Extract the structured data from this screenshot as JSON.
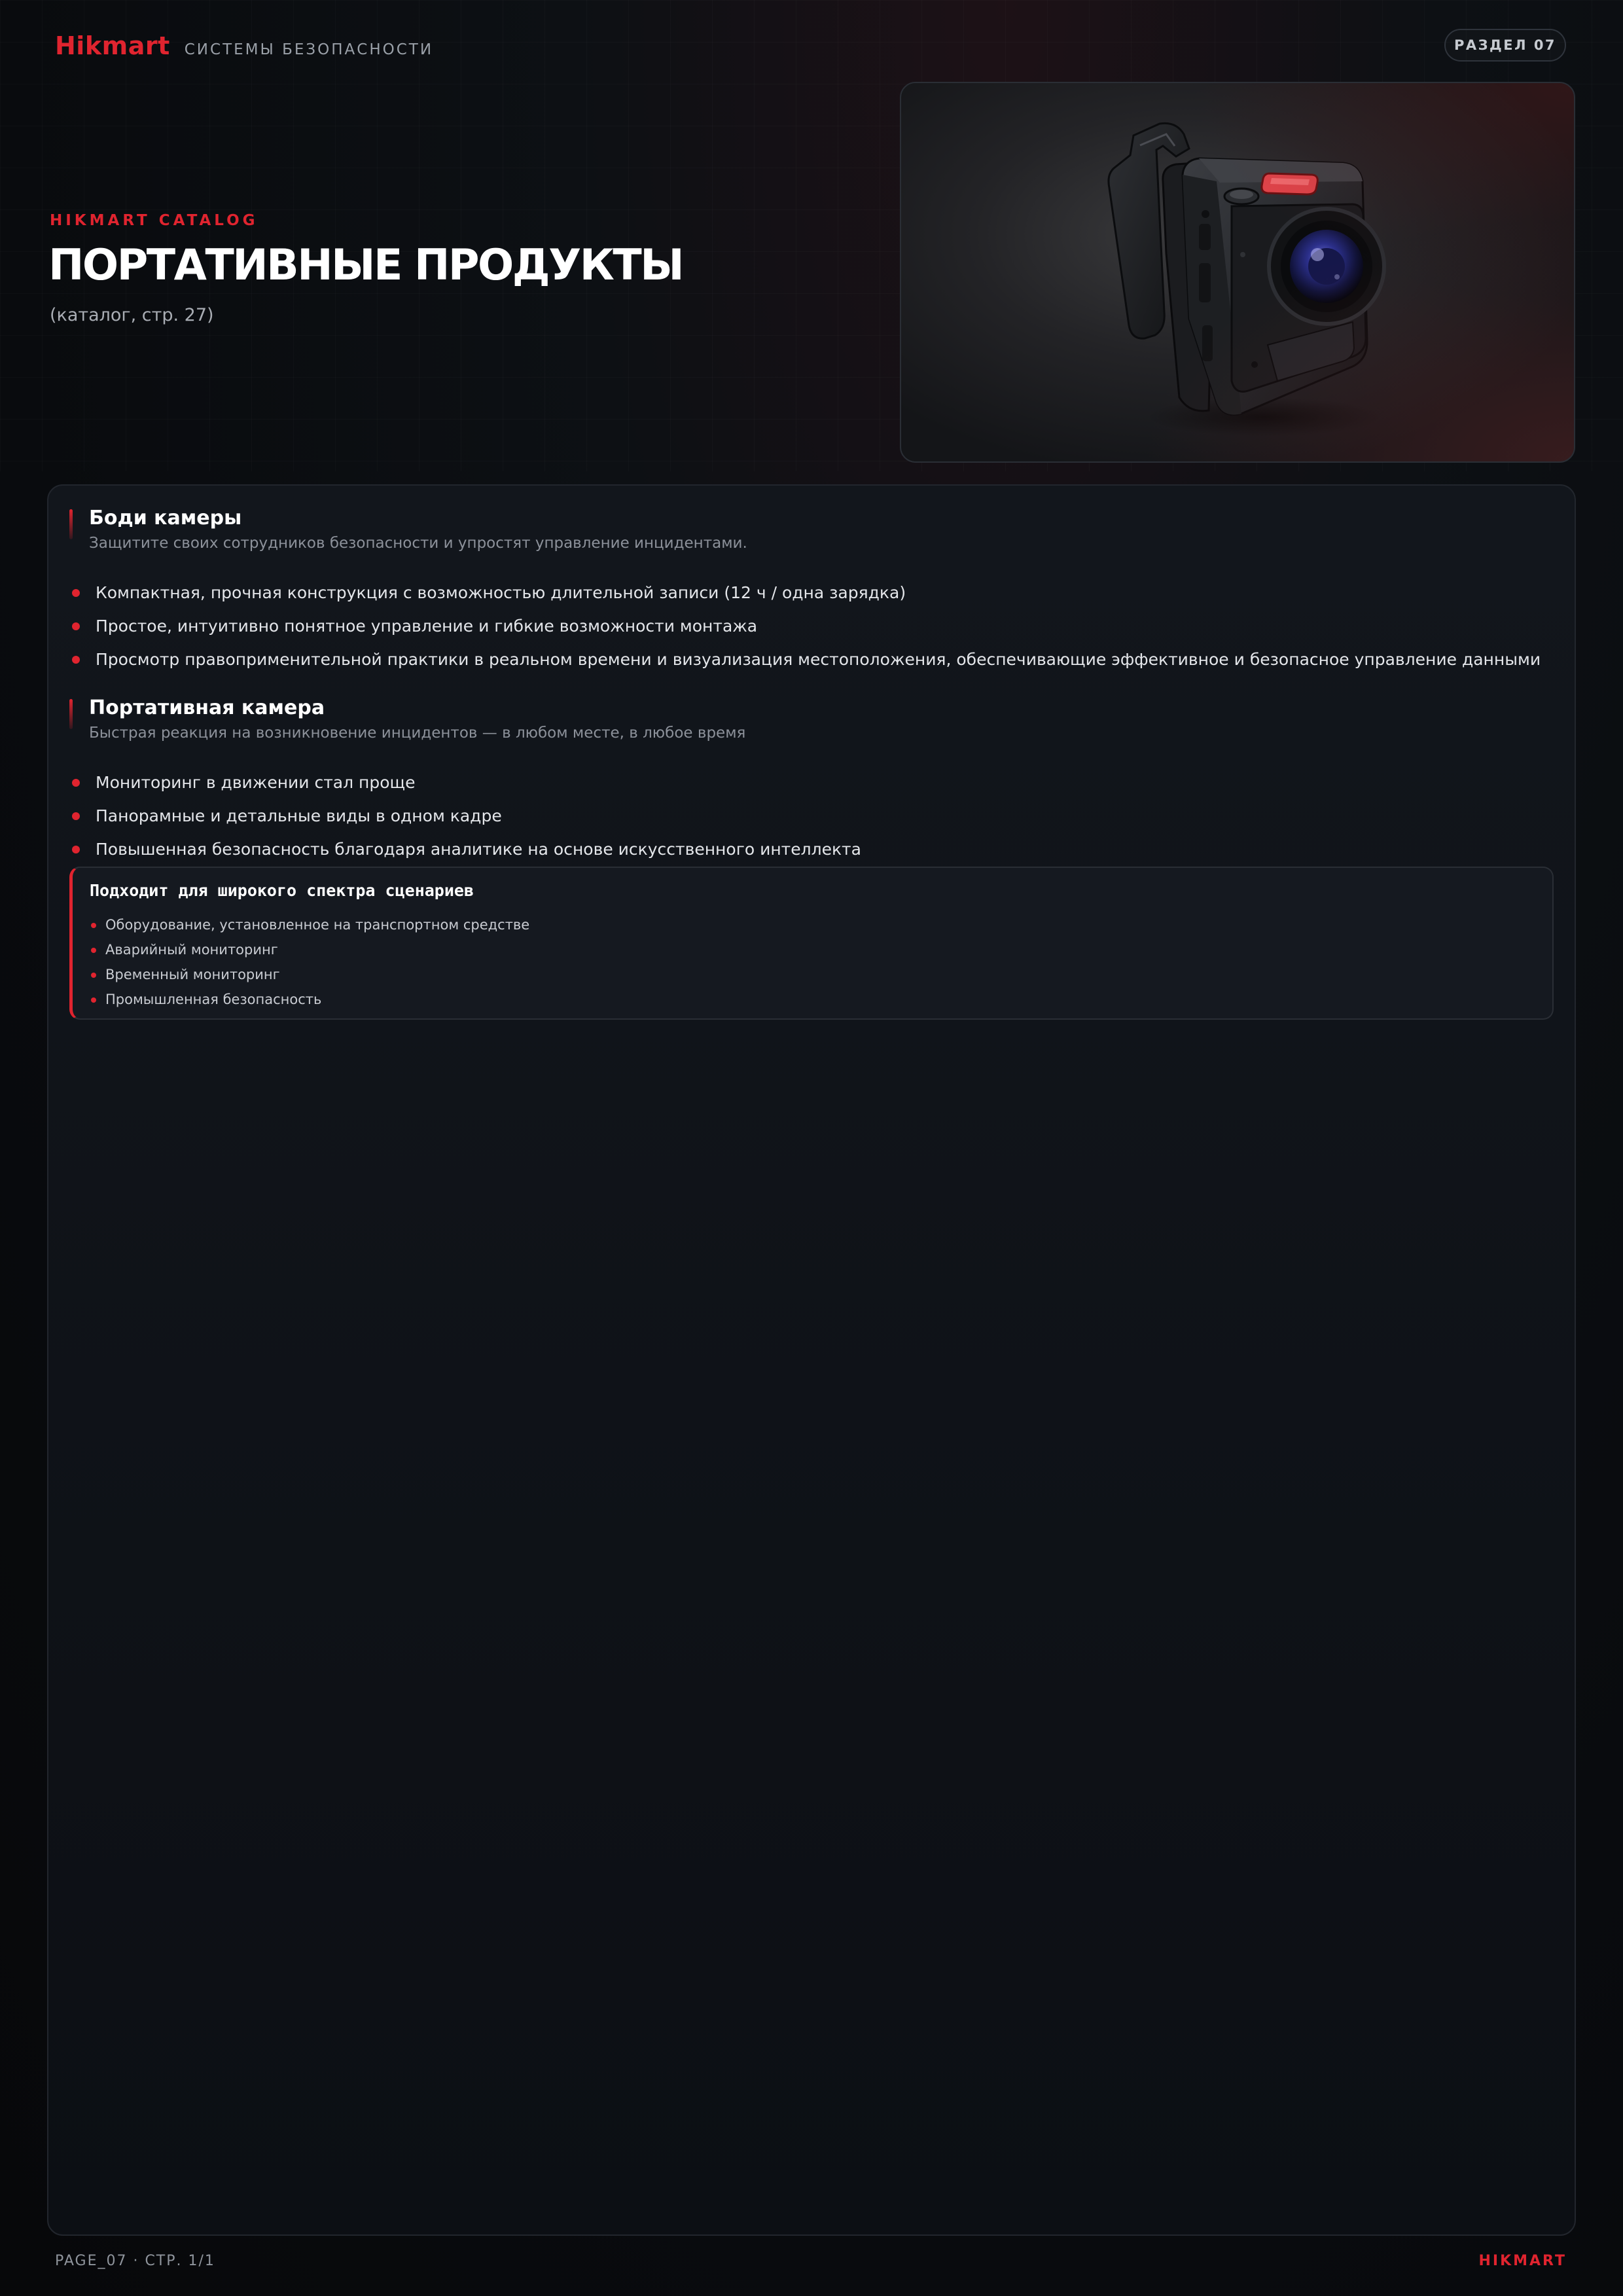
{
  "header": {
    "logo": "Hikmart",
    "subtitle": "СИСТЕМЫ БЕЗОПАСНОСТИ",
    "section_badge": "РАЗДЕЛ 07"
  },
  "hero": {
    "eyebrow": "HIKMART CATALOG",
    "title": "ПОРТАТИВНЫЕ ПРОДУКТЫ",
    "page_ref": "(каталог, стр. 27)"
  },
  "sections": [
    {
      "title": "Боди камеры",
      "subtitle": "Защитите своих сотрудников безопасности и упростят управление инцидентами.",
      "bullets": [
        "Компактная, прочная конструкция с возможностью длительной записи (12 ч / одна зарядка)",
        "Простое, интуитивно понятное управление и гибкие возможности монтажа",
        "Просмотр правоприменительной практики в реальном времени и визуализация местоположения, обеспечивающие эффективное и безопасное управление данными"
      ]
    },
    {
      "title": "Портативная камера",
      "subtitle": "Быстрая реакция на возникновение инцидентов — в любом месте, в любое время",
      "bullets": [
        "Мониторинг в движении стал проще",
        "Панорамные и детальные виды в одном кадре",
        "Повышенная безопасность благодаря аналитике на основе искусственного интеллекта"
      ]
    }
  ],
  "scenarios": {
    "title": "Подходит для широкого спектра сценариев",
    "items": [
      "Оборудование, установленное на транспортном средстве",
      "Аварийный мониторинг",
      "Временный мониторинг",
      "Промышленная безопасность"
    ]
  },
  "footer": {
    "left": "PAGE_07 · СТР. 1/1",
    "right": "HIKMART"
  },
  "colors": {
    "accent": "#e0242f",
    "background": "#0b0d11",
    "panel": "#10141a"
  }
}
